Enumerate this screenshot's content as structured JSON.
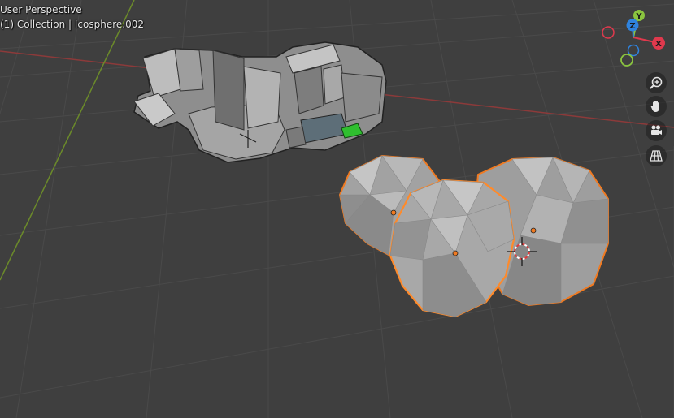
{
  "viewport": {
    "view_name": "User Perspective",
    "collection_prefix": "(1) Collection",
    "separator": "|",
    "active_object": "Icosphere.002"
  },
  "gizmo": {
    "x_label": "X",
    "y_label": "Y",
    "z_label": "Z",
    "x_color": "#e0394d",
    "y_color": "#8ac43f",
    "z_color": "#2f83de"
  },
  "navigation_buttons": [
    {
      "icon": "zoom-icon"
    },
    {
      "icon": "hand-pan-icon"
    },
    {
      "icon": "camera-icon"
    },
    {
      "icon": "grid-ortho-icon"
    }
  ],
  "colors": {
    "background": "#3f3f3f",
    "grid": "#4a4a4a",
    "x_axis_line": "#8c3a3a",
    "y_axis_line": "#6b8a2a",
    "selection_outline": "#f07a21",
    "mesh_fill": "#9a9a9a"
  }
}
